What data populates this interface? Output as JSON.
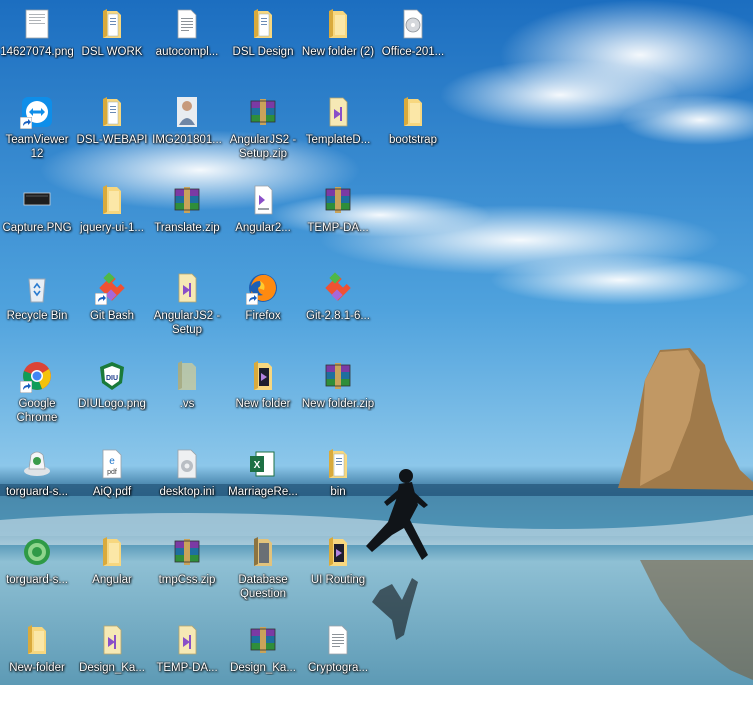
{
  "desktop": {
    "columns": [
      [
        {
          "label": "14627074.png",
          "icon": "image-file-icon"
        },
        {
          "label": "TeamViewer 12",
          "icon": "teamviewer-icon",
          "shortcut": true
        },
        {
          "label": "Capture.PNG",
          "icon": "image-file-icon-dark"
        },
        {
          "label": "Recycle Bin",
          "icon": "recycle-bin-icon"
        },
        {
          "label": "Google Chrome",
          "icon": "chrome-icon",
          "shortcut": true
        },
        {
          "label": "torguard-s...",
          "icon": "torguard-installer-icon"
        },
        {
          "label": "torguard-s...",
          "icon": "torguard-shield-icon"
        },
        {
          "label": "New-folder",
          "icon": "folder-icon"
        }
      ],
      [
        {
          "label": "DSL WORK",
          "icon": "folder-documents-icon"
        },
        {
          "label": "DSL-WEBAPI",
          "icon": "folder-documents-icon"
        },
        {
          "label": "jquery-ui-1...",
          "icon": "folder-icon"
        },
        {
          "label": "Git Bash",
          "icon": "git-icon",
          "shortcut": true
        },
        {
          "label": "DIULogo.png",
          "icon": "diu-logo-icon"
        },
        {
          "label": "AiQ.pdf",
          "icon": "pdf-icon"
        },
        {
          "label": "Angular",
          "icon": "folder-icon"
        },
        {
          "label": "Design_Ka...",
          "icon": "vs-solution-icon"
        }
      ],
      [
        {
          "label": "autocompl...",
          "icon": "text-file-icon"
        },
        {
          "label": "IMG201801...",
          "icon": "photo-file-icon"
        },
        {
          "label": "Translate.zip",
          "icon": "winrar-icon"
        },
        {
          "label": "AngularJS2 - Setup",
          "icon": "vs-solution-icon"
        },
        {
          "label": ".vs",
          "icon": "folder-hidden-icon"
        },
        {
          "label": "desktop.ini",
          "icon": "ini-file-icon"
        },
        {
          "label": "tmpCss.zip",
          "icon": "winrar-icon"
        },
        {
          "label": "TEMP-DA...",
          "icon": "vs-solution-icon"
        }
      ],
      [
        {
          "label": "DSL Design",
          "icon": "folder-documents-icon"
        },
        {
          "label": "AngularJS2 - Setup.zip",
          "icon": "winrar-icon"
        },
        {
          "label": "Angular2...",
          "icon": "vs-file-icon"
        },
        {
          "label": "Firefox",
          "icon": "firefox-icon",
          "shortcut": true
        },
        {
          "label": "New folder",
          "icon": "folder-vs-icon"
        },
        {
          "label": "MarriageRe...",
          "icon": "excel-icon"
        },
        {
          "label": "Database Question",
          "icon": "folder-dark-icon"
        },
        {
          "label": "Design_Ka...",
          "icon": "winrar-icon"
        }
      ],
      [
        {
          "label": "New folder (2)",
          "icon": "folder-icon"
        },
        {
          "label": "TemplateD...",
          "icon": "vs-solution-icon"
        },
        {
          "label": "TEMP-DA...",
          "icon": "winrar-icon"
        },
        {
          "label": "Git-2.8.1-6...",
          "icon": "git-icon"
        },
        {
          "label": "New folder.zip",
          "icon": "winrar-icon"
        },
        {
          "label": "bin",
          "icon": "folder-documents-icon"
        },
        {
          "label": "UI Routing",
          "icon": "folder-vs-icon"
        },
        {
          "label": "Cryptogra...",
          "icon": "text-file-icon"
        }
      ],
      [
        {
          "label": "Office-201...",
          "icon": "disc-image-icon"
        },
        {
          "label": "bootstrap",
          "icon": "folder-icon"
        }
      ]
    ]
  },
  "colors": {
    "sky_top": "#1f78c8",
    "sky_mid": "#4d9fdc",
    "sea": "#2f6f94",
    "sand": "#7fb3c9",
    "label": "#ffffff",
    "folder": "#f3cd6a",
    "folder_dark": "#dba93b"
  }
}
